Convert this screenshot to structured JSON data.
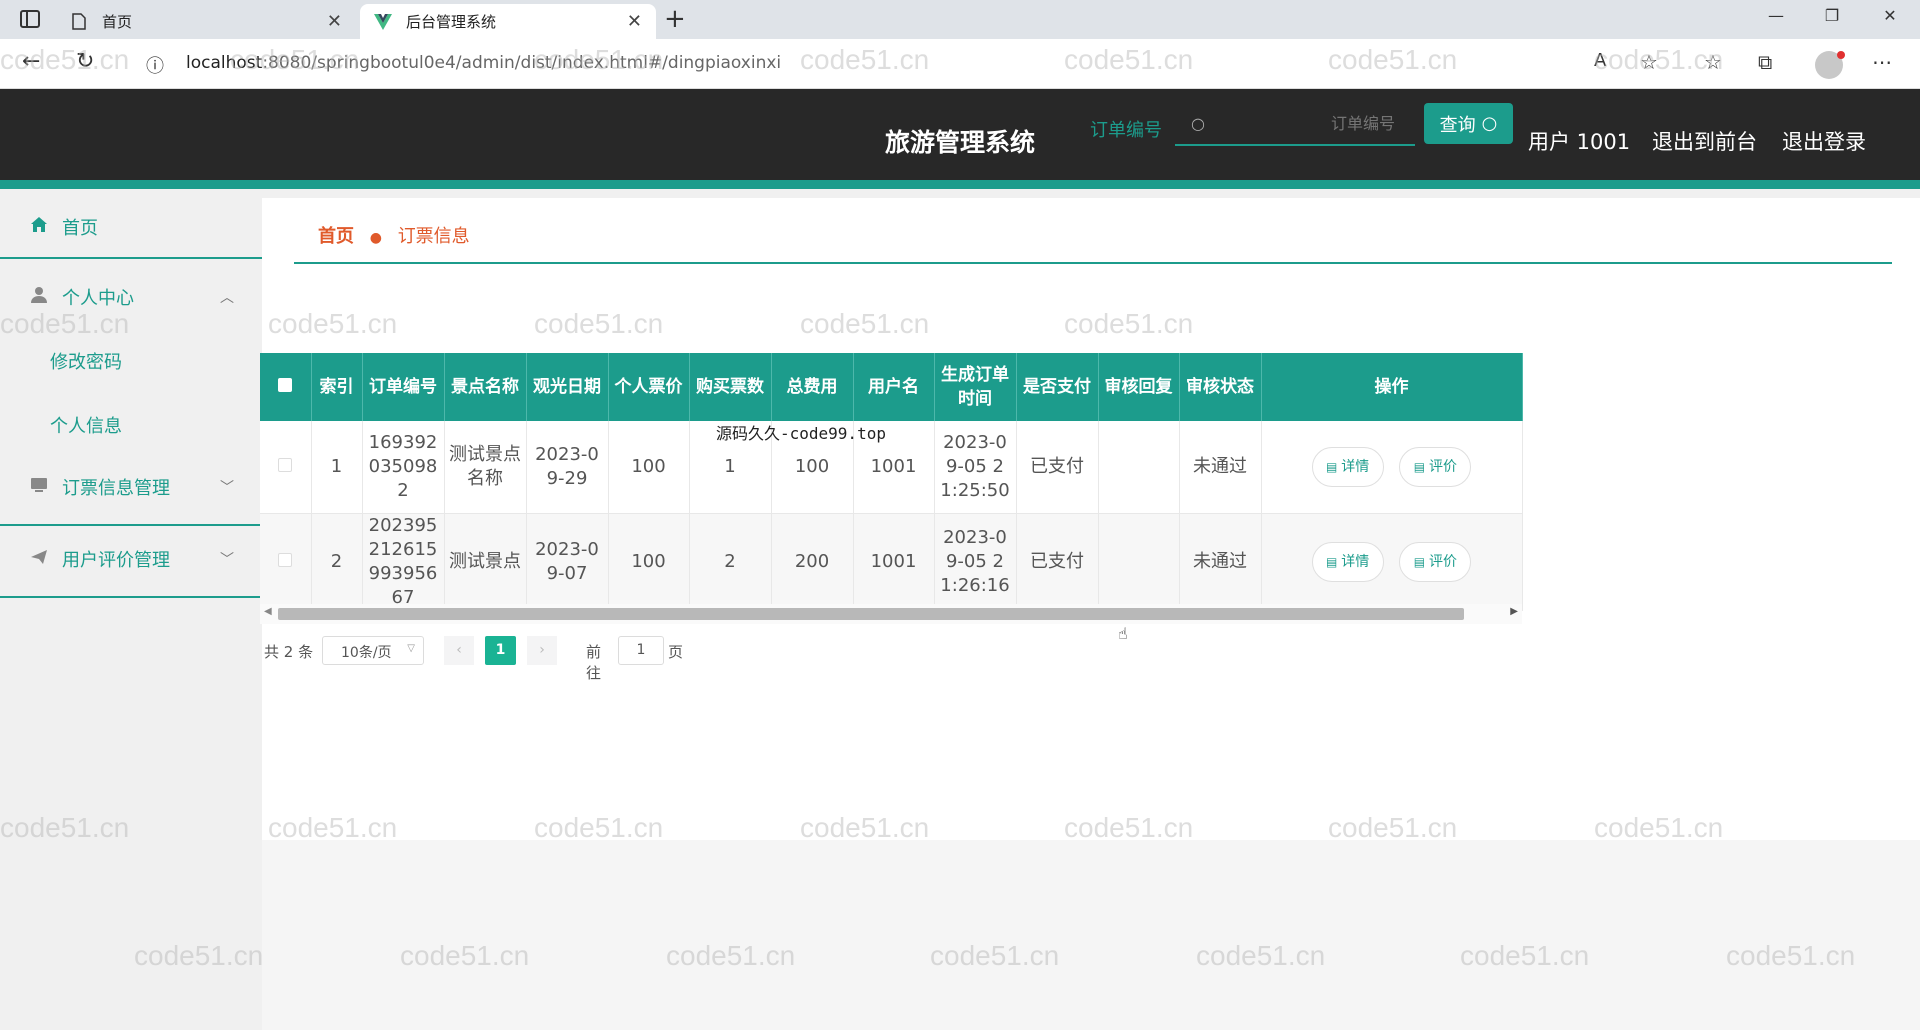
{
  "browser": {
    "tabs": [
      {
        "label": "首页"
      },
      {
        "label": "后台管理系统"
      }
    ],
    "url_host": "localhost",
    "url_rest": ":8080/springbootul0e4/admin/dist/index.html#/dingpiaoxinxi"
  },
  "header": {
    "title": "旅游管理系统",
    "user": "用户 1001",
    "to_front": "退出到前台",
    "logout": "退出登录"
  },
  "sidebar": {
    "home": "首页",
    "personal_center": "个人中心",
    "change_password": "修改密码",
    "personal_info": "个人信息",
    "ticket_management": "订票信息管理",
    "review_management": "用户评价管理"
  },
  "breadcrumb": {
    "home": "首页",
    "current": "订票信息"
  },
  "search": {
    "label": "订单编号",
    "placeholder": "订单编号",
    "button": "查询"
  },
  "table": {
    "columns": [
      "索引",
      "订单编号",
      "景点名称",
      "观光日期",
      "个人票价",
      "购买票数",
      "总费用",
      "用户名",
      "生成订单时间",
      "是否支付",
      "审核回复",
      "审核状态",
      "操作"
    ],
    "rows": [
      {
        "index": "1",
        "order_no": "1693920350982",
        "spot": "测试景点名称",
        "date": "2023-09-29",
        "price": "100",
        "count": "1",
        "total": "100",
        "user": "1001",
        "created": "2023-09-05 21:25:50",
        "paid": "已支付",
        "reply": "",
        "status": "未通过"
      },
      {
        "index": "2",
        "order_no": "20239521261599395667",
        "spot": "测试景点",
        "date": "2023-09-07",
        "price": "100",
        "count": "2",
        "total": "200",
        "user": "1001",
        "created": "2023-09-05 21:26:16",
        "paid": "已支付",
        "reply": "",
        "status": "未通过"
      }
    ],
    "detail_label": "详情",
    "review_label": "评价"
  },
  "pagination": {
    "total": "共 2 条",
    "page_size": "10条/页",
    "current_page": "1",
    "goto_prefix": "前往",
    "goto_value": "1",
    "goto_suffix": "页"
  },
  "overlay_text": "源码久久-code99.top",
  "watermark": "code51.cn",
  "colors": {
    "accent": "#1c9c8c",
    "header_bg": "#282828",
    "breadcrumb": "#e05a2b"
  }
}
